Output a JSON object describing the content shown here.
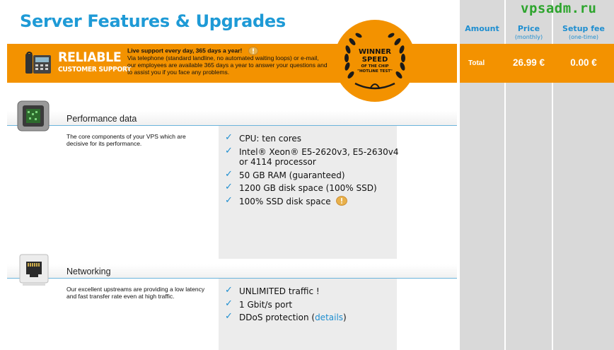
{
  "page": {
    "title": "Server Features & Upgrades"
  },
  "support": {
    "title": "RELIABLE",
    "subtitle": "CUSTOMER SUPPORT",
    "headline": "Live support every day, 365 days a year!",
    "body": "Via telephone (standard landline, no automated waiting loops) or e-mail, our employees are available 365 days a year to answer your questions and to assist you if you face any problems."
  },
  "badge": {
    "line1": "WINNER",
    "line2": "SPEED",
    "line3": "OF THE CHIP",
    "line4": "\"HOTLINE TEST\""
  },
  "performance": {
    "heading": "Performance data",
    "description": "The core components of your VPS which are decisive for its performance.",
    "features": [
      "CPU: ten cores",
      "Intel® Xeon® E5-2620v3, E5-2630v4 or 4114 processor",
      "50 GB RAM (guaranteed)",
      "1200 GB disk space (100% SSD)",
      "100% SSD disk space"
    ]
  },
  "networking": {
    "heading": "Networking",
    "description": "Our excellent upstreams are providing a low latency and fast transfer rate even at high traffic.",
    "features": [
      "UNLIMITED traffic !",
      "1 Gbit/s port"
    ],
    "ddos_prefix": "DDoS protection (",
    "ddos_link": "details",
    "ddos_suffix": ")"
  },
  "summary": {
    "amount_label": "Amount",
    "price_label": "Price",
    "price_sub": "(monthly)",
    "setup_label": "Setup fee",
    "setup_sub": "(one-time)",
    "total_label": "Total",
    "total_price": "26.99 €",
    "total_setup": "0.00 €"
  },
  "watermark": "vpsadm.ru",
  "colors": {
    "accent_blue": "#1e9ad6",
    "brand_orange": "#f39200",
    "panel_gray": "#d9d9d9",
    "watermark_green": "#2ea52e"
  }
}
